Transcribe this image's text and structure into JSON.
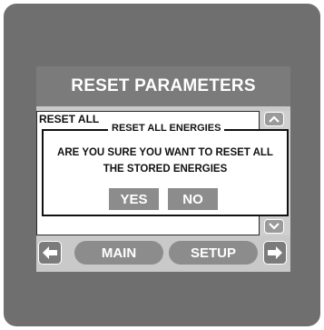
{
  "screen": {
    "title": "RESET PARAMETERS",
    "list_items": [
      "RESET ALL"
    ]
  },
  "dialog": {
    "title": "RESET ALL ENERGIES",
    "message_line1": "ARE YOU SURE YOU WANT TO RESET ALL",
    "message_line2": "THE STORED ENERGIES",
    "yes_label": "YES",
    "no_label": "NO"
  },
  "nav": {
    "main_label": "MAIN",
    "setup_label": "SETUP",
    "left_icon": "arrow-left-icon",
    "right_icon": "arrow-right-icon",
    "scroll_up_icon": "chevron-up-icon",
    "scroll_down_icon": "chevron-down-icon"
  },
  "colors": {
    "bezel": "#6f6f6f",
    "title_bar": "#7b7b7b",
    "button": "#8c8c8c",
    "screen_bg": "#c9c9c9"
  }
}
